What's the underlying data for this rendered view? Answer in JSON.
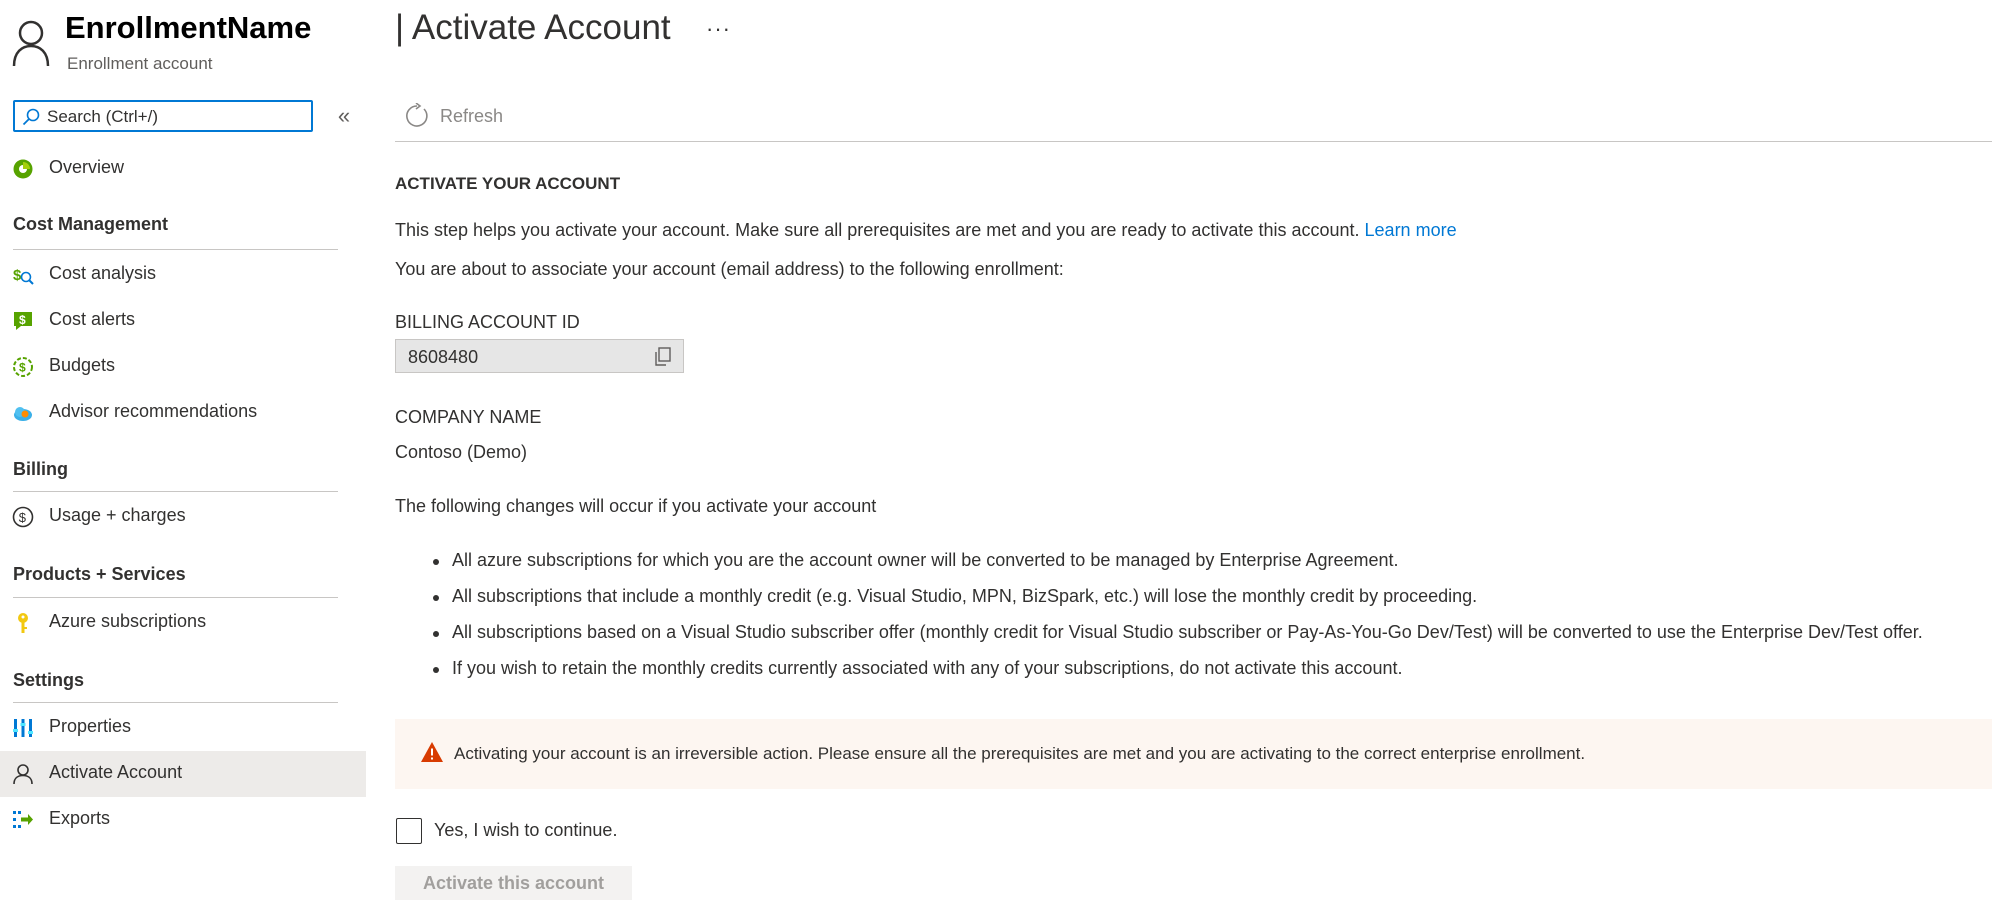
{
  "sidebar": {
    "enrollment_name": "EnrollmentName",
    "enrollment_subtitle": "Enrollment account",
    "search_placeholder": "Search (Ctrl+/)",
    "collapse_glyph": "«",
    "overview": {
      "label": "Overview",
      "icon": "overview-icon",
      "icon_color": "#57a300"
    },
    "sections": {
      "cost_management": "Cost Management",
      "billing": "Billing",
      "products_services": "Products + Services",
      "settings": "Settings"
    },
    "items": {
      "cost_analysis": {
        "label": "Cost analysis",
        "icon": "cost-analysis-icon"
      },
      "cost_alerts": {
        "label": "Cost alerts",
        "icon": "cost-alerts-icon"
      },
      "budgets": {
        "label": "Budgets",
        "icon": "budgets-icon"
      },
      "advisor": {
        "label": "Advisor recommendations",
        "icon": "advisor-icon"
      },
      "usage_charges": {
        "label": "Usage + charges",
        "icon": "usage-charges-icon"
      },
      "azure_subscriptions": {
        "label": "Azure subscriptions",
        "icon": "key-icon"
      },
      "properties": {
        "label": "Properties",
        "icon": "properties-icon"
      },
      "activate_account": {
        "label": "Activate Account",
        "icon": "person-icon",
        "active": true
      },
      "exports": {
        "label": "Exports",
        "icon": "exports-icon"
      }
    }
  },
  "header": {
    "title": "| Activate Account",
    "more": "···",
    "refresh_label": "Refresh"
  },
  "main": {
    "heading": "ACTIVATE YOUR ACCOUNT",
    "intro": "This step helps you activate your account. Make sure all prerequisites are met and you are ready to activate this account.",
    "learn_more": "Learn more",
    "associate": "You are about to associate your account (email address) to the following enrollment:",
    "billing_id_label": "BILLING ACCOUNT ID",
    "billing_id_value": "8608480",
    "company_label": "COMPANY NAME",
    "company_value": "Contoso (Demo)",
    "changes_intro": "The following changes will occur if you activate your account",
    "bullets": [
      "All azure subscriptions for which you are the account owner will be converted to be managed by Enterprise Agreement.",
      "All subscriptions that include a monthly credit (e.g. Visual Studio, MPN, BizSpark, etc.) will lose the monthly credit by proceeding.",
      "All subscriptions based on a Visual Studio subscriber offer (monthly credit for Visual Studio subscriber or Pay-As-You-Go Dev/Test) will be converted to use the Enterprise Dev/Test offer.",
      "If you wish to retain the monthly credits currently associated with any of your subscriptions, do not activate this account."
    ],
    "warning": "Activating your account is an irreversible action. Please ensure all the prerequisites are met and you are activating to the correct enterprise enrollment.",
    "checkbox_label": "Yes, I wish to continue.",
    "checkbox_checked": false,
    "activate_button": "Activate this account"
  },
  "colors": {
    "accent": "#0078d4",
    "warning": "#d83b01",
    "warning_bg": "#fdf6f1",
    "active_nav_bg": "#edebe9"
  }
}
